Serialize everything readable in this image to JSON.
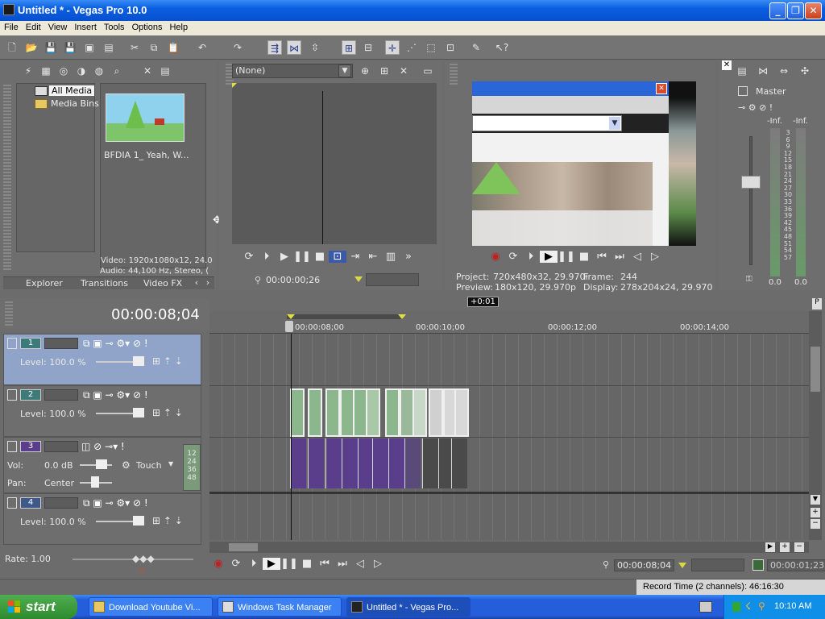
{
  "window": {
    "title": "Untitled * - Vegas Pro 10.0",
    "min": "_",
    "max": "❐",
    "close": "✕"
  },
  "menu": [
    "File",
    "Edit",
    "View",
    "Insert",
    "Tools",
    "Options",
    "Help"
  ],
  "explorer": {
    "tree": [
      "All Media",
      "Media Bins"
    ],
    "media_name": "BFDIA 1_ Yeah, W...",
    "media_info_video": "Video: 1920x1080x12, 24.0",
    "media_info_audio": "Audio: 44,100 Hz, Stereo, (",
    "tabs": [
      "Explorer",
      "Transitions",
      "Video FX"
    ]
  },
  "trimmer": {
    "dropdown": "(None)",
    "timecode": "00:00:00;26"
  },
  "preview": {
    "project_label": "Project:",
    "project_value": "720x480x32, 29.970i",
    "frame_label": "Frame:",
    "frame_value": "244",
    "preview_label": "Preview:",
    "preview_value": "180x120, 29.970p",
    "display_label": "Display:",
    "display_value": "278x204x24, 29.970"
  },
  "mixer": {
    "title": "Master",
    "left_label": "-Inf.",
    "right_label": "-Inf.",
    "scale": [
      "3",
      "6",
      "9",
      "12",
      "15",
      "18",
      "21",
      "24",
      "27",
      "30",
      "33",
      "36",
      "39",
      "42",
      "45",
      "48",
      "51",
      "54",
      "57"
    ],
    "left_value": "0.0",
    "right_value": "0.0"
  },
  "timeline": {
    "cursor_time": "00:00:08;04",
    "marker": "+0:01",
    "ruler": [
      "00:00:08;00",
      "00:00:10;00",
      "00:00:12;00",
      "00:00:14;00"
    ],
    "tracks": [
      {
        "num": "1",
        "level": "Level: 100.0 %"
      },
      {
        "num": "2",
        "level": "Level: 100.0 %"
      },
      {
        "num": "3",
        "vol_label": "Vol:",
        "vol": "0.0 dB",
        "mode": "Touch",
        "pan_label": "Pan:",
        "pan": "Center",
        "meter": [
          "12",
          "24",
          "36",
          "48"
        ]
      },
      {
        "num": "4",
        "level": "Level: 100.0 %"
      }
    ],
    "rate": "Rate: 1.00",
    "transport_time": "00:00:08;04",
    "end_time": "00:00:01;23",
    "record_time": "Record Time (2 channels): 46:16:30"
  },
  "taskbar": {
    "start": "start",
    "tasks": [
      "Download Youtube Vi...",
      "Windows Task Manager",
      "Untitled * - Vegas Pro..."
    ],
    "clock": "10:10 AM"
  },
  "colors": {
    "track_video": "#3e7a7a",
    "track_audio": "#5a3e8c",
    "selected_track": "#8fa4c8",
    "taskbar": "#245edb"
  }
}
